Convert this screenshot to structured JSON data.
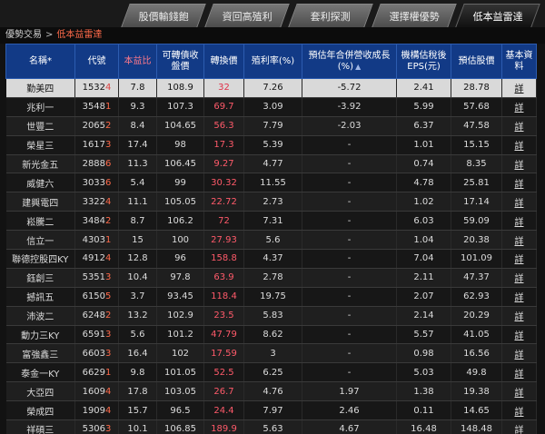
{
  "tabs": [
    {
      "label": "股價輸錢飽"
    },
    {
      "label": "資回高殖利"
    },
    {
      "label": "套利探測"
    },
    {
      "label": "選擇權優勢"
    },
    {
      "label": "低本益雷達"
    }
  ],
  "breadcrumb": {
    "parent": "優勢交易",
    "separator": ">",
    "current": "低本益雷達"
  },
  "columns": [
    "名稱*",
    "代號",
    "本益比",
    "可轉債收盤價",
    "轉換價",
    "殖利率(%)",
    "預估年合併營收成長(%)",
    "機構估稅後EPS(元)",
    "預估股價",
    "基本資料"
  ],
  "rows": [
    [
      "勤美四",
      "1532",
      "4",
      "7.8",
      "108.9",
      "32",
      "7.26",
      "-5.72",
      "2.41",
      "28.78",
      "詳"
    ],
    [
      "兆利一",
      "3548",
      "1",
      "9.3",
      "107.3",
      "69.7",
      "3.09",
      "-3.92",
      "5.99",
      "57.68",
      "詳"
    ],
    [
      "世豐二",
      "2065",
      "2",
      "8.4",
      "104.65",
      "56.3",
      "7.79",
      "-2.03",
      "6.37",
      "47.58",
      "詳"
    ],
    [
      "榮星三",
      "1617",
      "3",
      "17.4",
      "98",
      "17.3",
      "5.39",
      "-",
      "1.01",
      "15.15",
      "詳"
    ],
    [
      "新光金五",
      "2888",
      "6",
      "11.3",
      "106.45",
      "9.27",
      "4.77",
      "-",
      "0.74",
      "8.35",
      "詳"
    ],
    [
      "威健六",
      "3033",
      "6",
      "5.4",
      "99",
      "30.32",
      "11.55",
      "-",
      "4.78",
      "25.81",
      "詳"
    ],
    [
      "建興電四",
      "3322",
      "4",
      "11.1",
      "105.05",
      "22.72",
      "2.73",
      "-",
      "1.02",
      "17.14",
      "詳"
    ],
    [
      "崧騰二",
      "3484",
      "2",
      "8.7",
      "106.2",
      "72",
      "7.31",
      "-",
      "6.03",
      "59.09",
      "詳"
    ],
    [
      "信立一",
      "4303",
      "1",
      "15",
      "100",
      "27.93",
      "5.6",
      "-",
      "1.04",
      "20.38",
      "詳"
    ],
    [
      "聯德控股四KY",
      "4912",
      "4",
      "12.8",
      "96",
      "158.8",
      "4.37",
      "-",
      "7.04",
      "101.09",
      "詳"
    ],
    [
      "鈺創三",
      "5351",
      "3",
      "10.4",
      "97.8",
      "63.9",
      "2.78",
      "-",
      "2.11",
      "47.37",
      "詳"
    ],
    [
      "撼訊五",
      "6150",
      "5",
      "3.7",
      "93.45",
      "118.4",
      "19.75",
      "-",
      "2.07",
      "62.93",
      "詳"
    ],
    [
      "沛波二",
      "6248",
      "2",
      "13.2",
      "102.9",
      "23.5",
      "5.83",
      "-",
      "2.14",
      "20.29",
      "詳"
    ],
    [
      "動力三KY",
      "6591",
      "3",
      "5.6",
      "101.2",
      "47.79",
      "8.62",
      "-",
      "5.57",
      "41.05",
      "詳"
    ],
    [
      "富強鑫三",
      "6603",
      "3",
      "16.4",
      "102",
      "17.59",
      "3",
      "-",
      "0.98",
      "16.56",
      "詳"
    ],
    [
      "泰金一KY",
      "6629",
      "1",
      "9.8",
      "101.05",
      "52.5",
      "6.25",
      "-",
      "5.03",
      "49.8",
      "詳"
    ],
    [
      "大亞四",
      "1609",
      "4",
      "17.8",
      "103.05",
      "26.7",
      "4.76",
      "1.97",
      "1.38",
      "19.38",
      "詳"
    ],
    [
      "榮成四",
      "1909",
      "4",
      "15.7",
      "96.5",
      "24.4",
      "7.97",
      "2.46",
      "0.11",
      "14.65",
      "詳"
    ],
    [
      "祥碩三",
      "5306",
      "3",
      "10.1",
      "106.85",
      "189.9",
      "5.63",
      "4.67",
      "16.48",
      "148.48",
      "詳"
    ]
  ]
}
